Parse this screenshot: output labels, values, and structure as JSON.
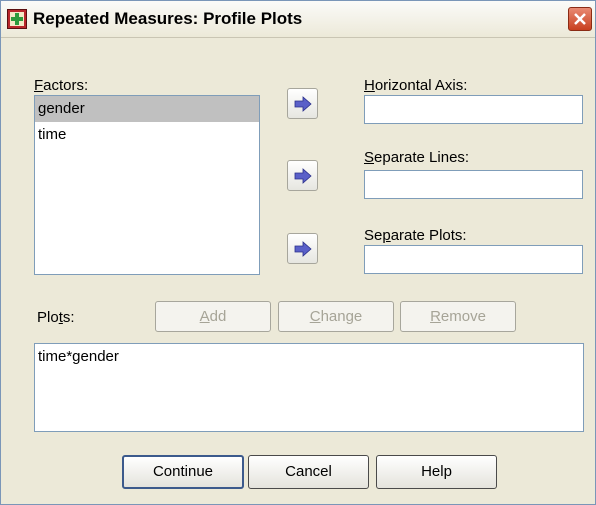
{
  "window": {
    "title": "Repeated Measures: Profile Plots"
  },
  "factors": {
    "label_mnemonic": "F",
    "label_rest": "actors:",
    "items": [
      "gender",
      "time"
    ],
    "selected_index": 0
  },
  "horizontal_axis": {
    "label_mnemonic": "H",
    "label_rest": "orizontal Axis:",
    "value": ""
  },
  "separate_lines": {
    "label_mnemonic": "S",
    "label_rest": "eparate Lines:",
    "value": ""
  },
  "separate_plots": {
    "label_pre": "Se",
    "label_mnemonic": "p",
    "label_rest": "arate Plots:",
    "value": ""
  },
  "plots": {
    "label_pre": "Plo",
    "label_mnemonic": "t",
    "label_rest": "s:",
    "add_mnemonic": "A",
    "add_rest": "dd",
    "change_mnemonic": "C",
    "change_rest": "hange",
    "remove_mnemonic": "R",
    "remove_rest": "emove",
    "items": [
      "time*gender"
    ]
  },
  "footer": {
    "continue_label": "Continue",
    "cancel_label": "Cancel",
    "help_label": "Help"
  },
  "colors": {
    "dialog_bg": "#ece9d8",
    "arrow_blue": "#5a60c8",
    "disabled_text": "#a6a497",
    "close_red": "#c8401f"
  }
}
